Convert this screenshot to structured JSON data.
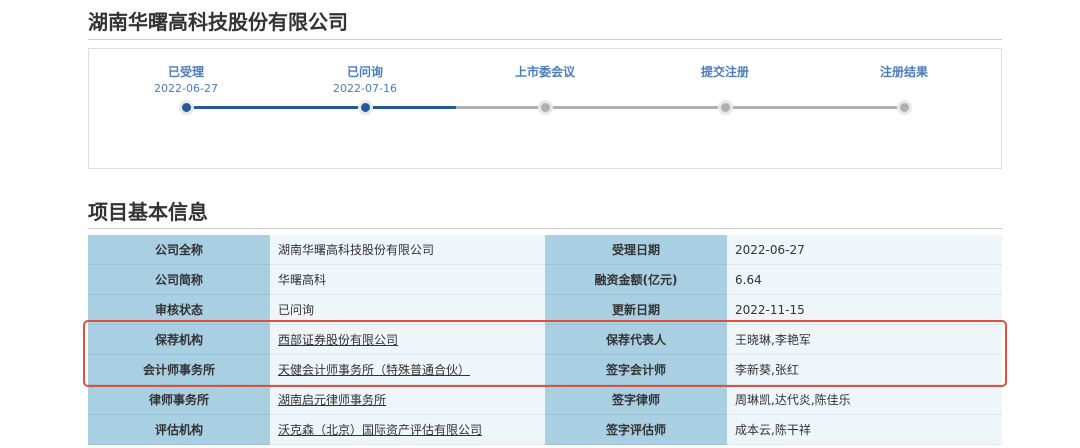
{
  "title": "湖南华曙高科技股份有限公司",
  "progress": {
    "steps": [
      {
        "label": "已受理",
        "date": "2022-06-27",
        "done": true
      },
      {
        "label": "已问询",
        "date": "2022-07-16",
        "done": true
      },
      {
        "label": "上市委会议",
        "date": "",
        "done": false
      },
      {
        "label": "提交注册",
        "date": "",
        "done": false
      },
      {
        "label": "注册结果",
        "date": "",
        "done": false
      }
    ],
    "active_color": "#24589a",
    "inactive_color": "#b0b0b0"
  },
  "section_title": "项目基本信息",
  "rows": [
    {
      "l1": "公司全称",
      "v1": "湖南华曙高科技股份有限公司",
      "link1": false,
      "l2": "受理日期",
      "v2": "2022-06-27"
    },
    {
      "l1": "公司简称",
      "v1": "华曙高科",
      "link1": false,
      "l2": "融资金额(亿元)",
      "v2": "6.64"
    },
    {
      "l1": "审核状态",
      "v1": "已问询",
      "link1": false,
      "l2": "更新日期",
      "v2": "2022-11-15"
    },
    {
      "l1": "保荐机构",
      "v1": "西部证券股份有限公司",
      "link1": true,
      "l2": "保荐代表人",
      "v2": "王晓琳,李艳军"
    },
    {
      "l1": "会计师事务所",
      "v1": "天健会计师事务所（特殊普通合伙）",
      "link1": true,
      "l2": "签字会计师",
      "v2": "李新葵,张红"
    },
    {
      "l1": "律师事务所",
      "v1": "湖南启元律师事务所",
      "link1": true,
      "l2": "签字律师",
      "v2": "周琳凯,达代炎,陈佳乐"
    },
    {
      "l1": "评估机构",
      "v1": "沃克森（北京）国际资产评估有限公司",
      "link1": true,
      "l2": "签字评估师",
      "v2": "成本云,陈干祥"
    }
  ]
}
